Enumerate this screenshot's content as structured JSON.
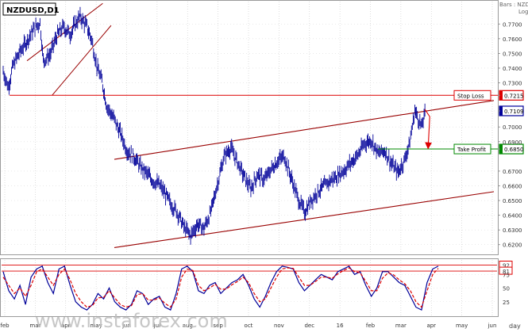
{
  "chart_data": [
    {
      "type": "line",
      "title": "NZDUSD,D1",
      "watermark": "www.instaforex.com",
      "top_right_text": "Bars : NZD",
      "scale_label": "Log",
      "x_months": [
        "feb",
        "mar",
        "apr",
        "may",
        "jun",
        "jul",
        "aug",
        "sep",
        "oct",
        "nov",
        "dec",
        "16",
        "feb",
        "mar",
        "apr",
        "may",
        "jun"
      ],
      "xlabel": "day",
      "y_ticks": [
        "0.7700",
        "0.7600",
        "0.7500",
        "0.7400",
        "0.7300",
        "0.7215",
        "0.7109",
        "0.7000",
        "0.6900",
        "0.6850",
        "0.6700",
        "0.6600",
        "0.6500",
        "0.6400",
        "0.6300",
        "0.6200"
      ],
      "ylim": [
        0.615,
        0.782
      ],
      "price_path": [
        [
          0,
          0.738
        ],
        [
          3,
          0.727
        ],
        [
          6,
          0.742
        ],
        [
          10,
          0.751
        ],
        [
          14,
          0.758
        ],
        [
          18,
          0.766
        ],
        [
          22,
          0.771
        ],
        [
          24,
          0.745
        ],
        [
          28,
          0.749
        ],
        [
          32,
          0.762
        ],
        [
          36,
          0.768
        ],
        [
          40,
          0.763
        ],
        [
          43,
          0.77
        ],
        [
          46,
          0.775
        ],
        [
          50,
          0.768
        ],
        [
          53,
          0.759
        ],
        [
          56,
          0.741
        ],
        [
          59,
          0.731
        ],
        [
          62,
          0.714
        ],
        [
          66,
          0.706
        ],
        [
          70,
          0.696
        ],
        [
          74,
          0.684
        ],
        [
          78,
          0.68
        ],
        [
          82,
          0.673
        ],
        [
          86,
          0.668
        ],
        [
          90,
          0.663
        ],
        [
          93,
          0.661
        ],
        [
          96,
          0.656
        ],
        [
          100,
          0.648
        ],
        [
          104,
          0.642
        ],
        [
          108,
          0.632
        ],
        [
          112,
          0.626
        ],
        [
          116,
          0.634
        ],
        [
          120,
          0.631
        ],
        [
          124,
          0.642
        ],
        [
          128,
          0.661
        ],
        [
          132,
          0.68
        ],
        [
          136,
          0.686
        ],
        [
          140,
          0.676
        ],
        [
          144,
          0.666
        ],
        [
          148,
          0.658
        ],
        [
          152,
          0.668
        ],
        [
          156,
          0.664
        ],
        [
          160,
          0.671
        ],
        [
          164,
          0.677
        ],
        [
          168,
          0.68
        ],
        [
          172,
          0.666
        ],
        [
          176,
          0.652
        ],
        [
          180,
          0.642
        ],
        [
          184,
          0.65
        ],
        [
          188,
          0.656
        ],
        [
          192,
          0.66
        ],
        [
          196,
          0.664
        ],
        [
          200,
          0.667
        ],
        [
          204,
          0.671
        ],
        [
          208,
          0.676
        ],
        [
          212,
          0.681
        ],
        [
          216,
          0.689
        ],
        [
          220,
          0.691
        ],
        [
          224,
          0.682
        ],
        [
          228,
          0.684
        ],
        [
          232,
          0.675
        ],
        [
          236,
          0.669
        ],
        [
          240,
          0.678
        ],
        [
          243,
          0.69
        ],
        [
          246,
          0.711
        ],
        [
          248,
          0.706
        ],
        [
          250,
          0.7
        ],
        [
          252,
          0.709
        ]
      ],
      "support_line": {
        "label": "",
        "from": [
          0,
          0.618
        ],
        "to": [
          260,
          0.656
        ]
      },
      "resistance_line": {
        "label": "",
        "from": [
          0,
          0.678
        ],
        "to": [
          260,
          0.718
        ]
      },
      "early_channel": [
        {
          "from": [
            0,
            0.745
          ],
          "to": [
            50,
            0.784
          ]
        },
        {
          "from": [
            15,
            0.7215
          ],
          "to": [
            55,
            0.769
          ]
        }
      ],
      "levels": [
        {
          "name": "Stop Loss",
          "value": 0.7215,
          "color": "#dd0000",
          "value_label": "0.7215"
        },
        {
          "name": "Take Profit",
          "value": 0.685,
          "color": "#008800",
          "value_label": "0.6850"
        }
      ],
      "current_price": {
        "value": 0.7109,
        "label": "0.7109",
        "color": "#000099"
      },
      "color_price": "#000099",
      "color_channel": "#990000"
    },
    {
      "type": "line",
      "title": "",
      "y_ticks": [
        "92",
        "81",
        "75",
        "50",
        "25"
      ],
      "ylim": [
        0,
        100
      ],
      "series": [
        {
          "name": "",
          "color": "#000099",
          "values": [
            80,
            45,
            30,
            55,
            20,
            70,
            85,
            90,
            60,
            40,
            85,
            90,
            55,
            25,
            15,
            10,
            20,
            40,
            30,
            50,
            25,
            15,
            10,
            20,
            45,
            40,
            20,
            30,
            35,
            15,
            10,
            40,
            85,
            90,
            80,
            45,
            40,
            55,
            60,
            40,
            50,
            60,
            65,
            75,
            55,
            30,
            15,
            35,
            60,
            80,
            90,
            88,
            85,
            60,
            45,
            55,
            65,
            75,
            70,
            65,
            80,
            85,
            90,
            75,
            80,
            55,
            35,
            50,
            80,
            80,
            70,
            60,
            55,
            35,
            15,
            10,
            60,
            85,
            90
          ]
        },
        {
          "name": "",
          "color": "#dd0000",
          "values": [
            70,
            55,
            40,
            50,
            35,
            55,
            80,
            85,
            70,
            55,
            75,
            85,
            65,
            40,
            25,
            15,
            18,
            32,
            33,
            45,
            32,
            20,
            15,
            18,
            38,
            40,
            28,
            28,
            32,
            22,
            15,
            30,
            70,
            85,
            82,
            55,
            45,
            50,
            57,
            48,
            48,
            56,
            62,
            70,
            60,
            40,
            25,
            30,
            50,
            70,
            85,
            87,
            86,
            70,
            55,
            55,
            62,
            70,
            70,
            68,
            76,
            82,
            87,
            80,
            78,
            62,
            45,
            45,
            68,
            78,
            74,
            65,
            58,
            45,
            25,
            15,
            45,
            75,
            86
          ]
        }
      ],
      "levels": [
        {
          "value": 92,
          "label": "92",
          "color": "#dd0000"
        },
        {
          "value": 81,
          "label": "81",
          "color": "#dd0000"
        }
      ]
    }
  ]
}
